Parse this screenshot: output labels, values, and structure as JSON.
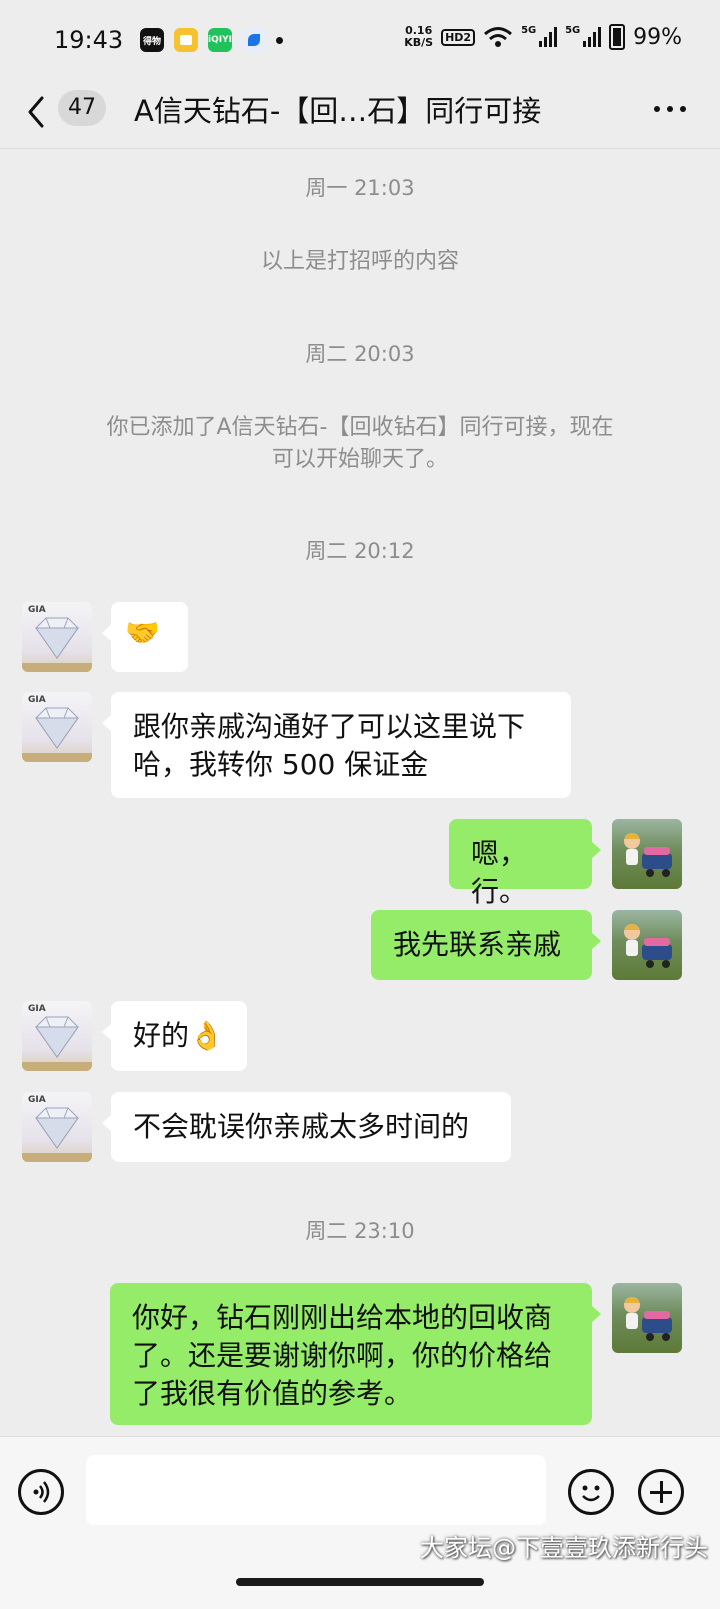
{
  "status_bar": {
    "time": "19:43",
    "net_speed_value": "0.16",
    "net_speed_unit": "KB/S",
    "hd_label": "HD2",
    "sim1_label": "5G",
    "sim2_label": "5G",
    "battery": "99%",
    "app_icons": [
      "得物",
      "notes-app-icon",
      "iQIYI",
      "feather-app-icon"
    ]
  },
  "header": {
    "back_icon": "chevron-left-icon",
    "unread_count": "47",
    "title": "A信天钻石-【回…石】同行可接",
    "more_icon": "more-dots-icon"
  },
  "messages": [
    {
      "type": "time",
      "text": "周一 21:03"
    },
    {
      "type": "system",
      "text": "以上是打招呼的内容"
    },
    {
      "type": "time",
      "text": "周二 20:03"
    },
    {
      "type": "system",
      "lines": [
        "你已添加了A信天钻石-【回收钻石】同行可接，现在",
        "可以开始聊天了。"
      ]
    },
    {
      "type": "time",
      "text": "周二 20:12"
    },
    {
      "type": "left",
      "avatar": "GIA diamond avatar",
      "text": "🤝"
    },
    {
      "type": "left",
      "avatar": "GIA diamond avatar",
      "lines": [
        "跟你亲戚沟通好了可以这里说下",
        "哈，我转你 500 保证金"
      ]
    },
    {
      "type": "right",
      "avatar": "toy figure avatar",
      "text": "嗯，行。"
    },
    {
      "type": "right",
      "avatar": "toy figure avatar",
      "text": "我先联系亲戚"
    },
    {
      "type": "left",
      "avatar": "GIA diamond avatar",
      "text": "好的👌"
    },
    {
      "type": "left",
      "avatar": "GIA diamond avatar",
      "text": "不会耽误你亲戚太多时间的"
    },
    {
      "type": "time",
      "text": "周二 23:10"
    },
    {
      "type": "right",
      "avatar": "toy figure avatar",
      "lines": [
        "你好，钻石刚刚出给本地的回收商",
        "了。还是要谢谢你啊，你的价格给",
        "了我很有价值的参考。"
      ]
    }
  ],
  "avatar_labels": {
    "gia": "GIA"
  },
  "input_bar": {
    "voice_icon": "voice-icon",
    "emoji_icon": "emoji-icon",
    "plus_icon": "plus-icon",
    "text_value": ""
  },
  "watermark": "大家坛@下壹壹玖添新行头",
  "colors": {
    "background": "#ededed",
    "my_bubble": "#95ec69",
    "their_bubble": "#ffffff",
    "system_text": "#8d8d8d"
  }
}
